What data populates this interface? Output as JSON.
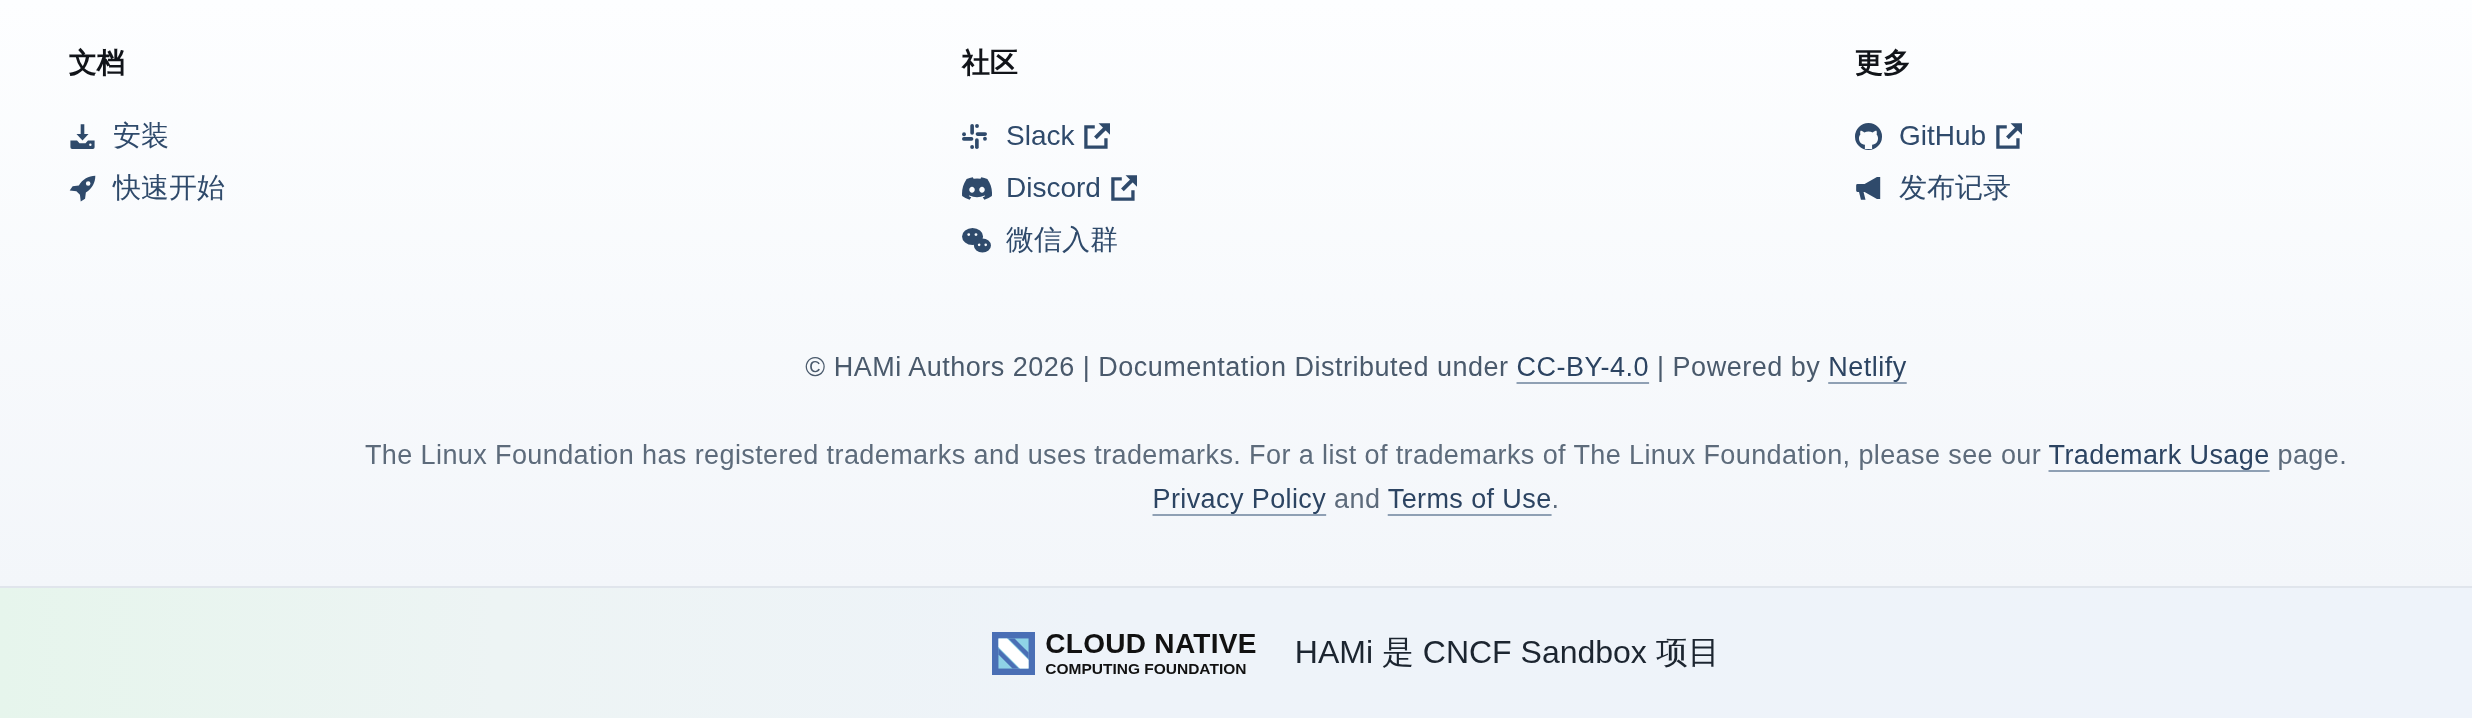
{
  "link_columns": [
    {
      "heading": "文档",
      "links": [
        {
          "label": "安装",
          "external": false
        },
        {
          "label": "快速开始",
          "external": false
        }
      ]
    },
    {
      "heading": "社区",
      "links": [
        {
          "label": "Slack",
          "external": true
        },
        {
          "label": "Discord",
          "external": true
        },
        {
          "label": "微信入群",
          "external": false
        }
      ]
    },
    {
      "heading": "更多",
      "links": [
        {
          "label": "GitHub",
          "external": true
        },
        {
          "label": "发布记录",
          "external": false
        }
      ]
    }
  ],
  "copyright": [
    {
      "kind": "text",
      "text": "© HAMi Authors 2026 | Documentation Distributed under "
    },
    {
      "kind": "link",
      "text": "CC-BY-4.0"
    },
    {
      "kind": "text",
      "text": " | Powered by "
    },
    {
      "kind": "link",
      "text": "Netlify"
    }
  ],
  "trademark_lines": [
    [
      {
        "kind": "text",
        "text": "The Linux Foundation has registered trademarks and uses trademarks. For a list of trademarks of The Linux Foundation, please see our "
      },
      {
        "kind": "link",
        "text": "Trademark Usage"
      },
      {
        "kind": "text",
        "text": " page."
      }
    ],
    [
      {
        "kind": "link",
        "text": "Privacy Policy"
      },
      {
        "kind": "text",
        "text": " and "
      },
      {
        "kind": "link",
        "text": "Terms of Use"
      },
      {
        "kind": "text",
        "text": "."
      }
    ]
  ],
  "cncf": {
    "logo_lines": [
      "CLOUD NATIVE",
      "COMPUTING FOUNDATION"
    ],
    "statement": "HAMi 是 CNCF Sandbox 项目"
  }
}
